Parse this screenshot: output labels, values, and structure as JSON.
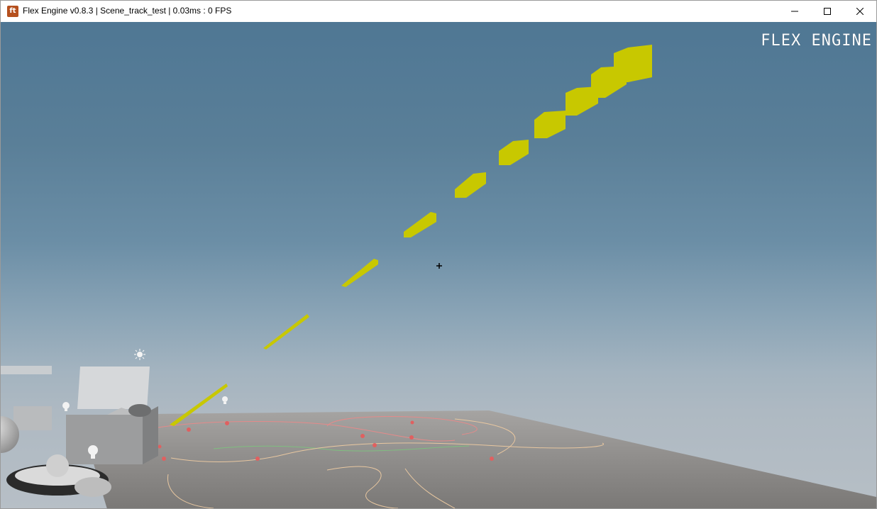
{
  "window": {
    "app_icon_label": "ft",
    "title": "Flex Engine v0.8.3 | Scene_track_test | 0.03ms : 0 FPS",
    "controls": {
      "minimize": "minimize-icon",
      "maximize": "maximize-icon",
      "close": "close-icon"
    }
  },
  "viewport": {
    "overlay_title": "FLEX ENGINE",
    "crosshair": "crosshair-icon",
    "icons": [
      "sun-icon",
      "light-bulb-icon"
    ]
  },
  "colors": {
    "sky_top": "#4f7794",
    "sky_bottom": "#b7bfc6",
    "track_yellow": "#c8c800",
    "ground": "#8e8c8a",
    "close_hover": "#e81123"
  }
}
